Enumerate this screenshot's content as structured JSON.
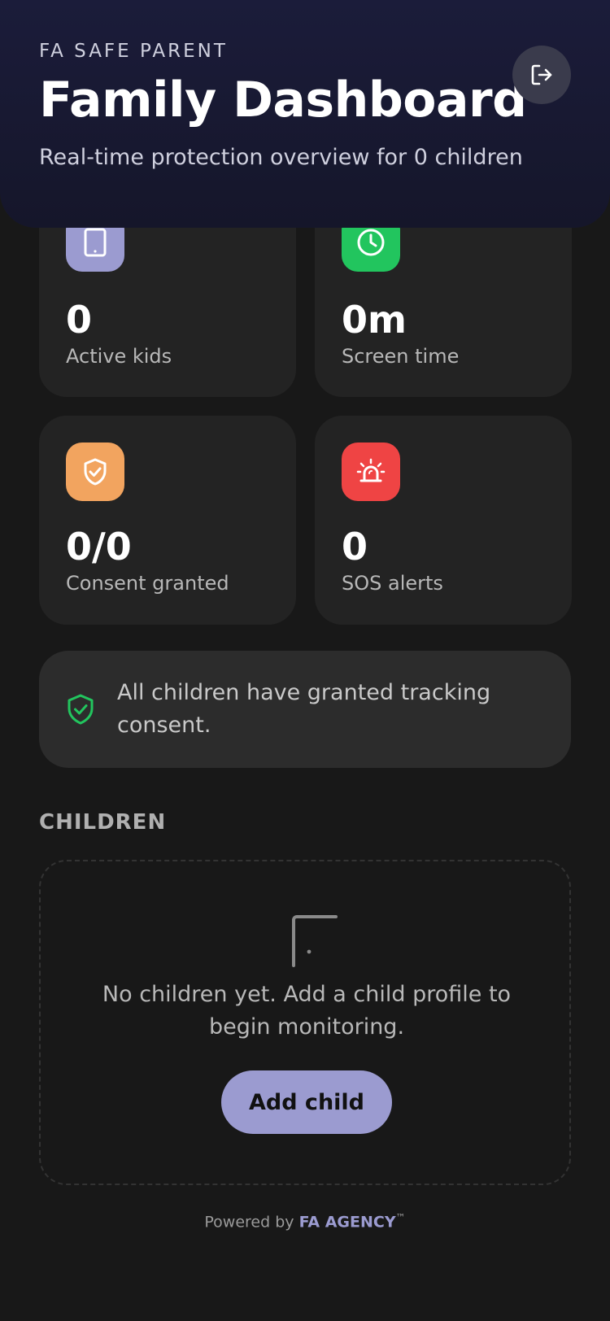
{
  "header": {
    "brand": "FA SAFE PARENT",
    "title": "Family Dashboard",
    "subtitle": "Real-time protection overview for 0 children",
    "logout_icon": "logout-icon"
  },
  "stats": [
    {
      "value": "0",
      "label": "Active kids",
      "icon": "tablet-icon",
      "color": "#9b9bd0"
    },
    {
      "value": "0m",
      "label": "Screen time",
      "icon": "clock-icon",
      "color": "#22c55e"
    },
    {
      "value": "0/0",
      "label": "Consent granted",
      "icon": "shield-check-icon",
      "color": "#f2a45f"
    },
    {
      "value": "0",
      "label": "SOS alerts",
      "icon": "siren-icon",
      "color": "#ef4444"
    }
  ],
  "consent_banner": {
    "icon": "shield-check-icon",
    "text": "All children have granted tracking consent.",
    "color": "#22c55e"
  },
  "children": {
    "heading": "CHILDREN",
    "empty_icon": "tablet-icon",
    "empty_text": "No children yet. Add a child profile to begin monitoring.",
    "add_button": "Add child"
  },
  "footer": {
    "prefix": "Powered by ",
    "brand": "FA AGENCY",
    "trademark": "™"
  },
  "colors": {
    "background": "#181818",
    "card": "#232323",
    "accent": "#9b9bd0"
  }
}
